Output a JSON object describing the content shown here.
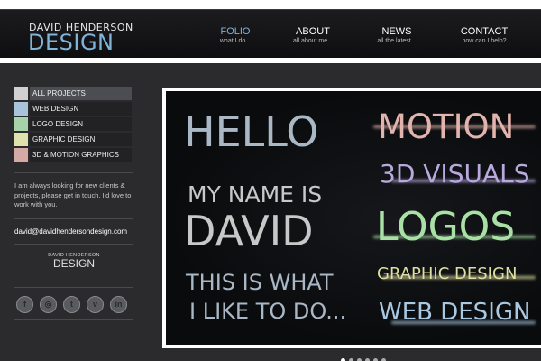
{
  "logo": {
    "top": "DAVID HENDERSON",
    "bottom": "DESIGN"
  },
  "nav": [
    {
      "label": "FOLIO",
      "sub": "what I do...",
      "active": true
    },
    {
      "label": "ABOUT",
      "sub": "all about me...",
      "active": false
    },
    {
      "label": "NEWS",
      "sub": "all the latest...",
      "active": false
    },
    {
      "label": "CONTACT",
      "sub": "how can I help?",
      "active": false
    }
  ],
  "categories": [
    {
      "label": "ALL PROJECTS",
      "color": "#d0d0d0",
      "active": true
    },
    {
      "label": "WEB DESIGN",
      "color": "#a8c4da"
    },
    {
      "label": "LOGO DESIGN",
      "color": "#a6d3a8"
    },
    {
      "label": "GRAPHIC DESIGN",
      "color": "#dfe2ad"
    },
    {
      "label": "3D & MOTION GRAPHICS",
      "color": "#d5aaa6"
    }
  ],
  "blurb": "I am always looking for new clients & projects, please get in touch. I'd love to work with you.",
  "email": "david@davidhendersondesign.com",
  "mini_logo": {
    "top": "DAVID HENDERSON",
    "bottom": "DESIGN"
  },
  "socials": [
    {
      "icon": "facebook-icon",
      "glyph": "f"
    },
    {
      "icon": "dribbble-icon",
      "glyph": "◎"
    },
    {
      "icon": "twitter-icon",
      "glyph": "t"
    },
    {
      "icon": "vimeo-icon",
      "glyph": "v"
    },
    {
      "icon": "linkedin-icon",
      "glyph": "in"
    }
  ],
  "slide": {
    "left": [
      "HELLO",
      "MY NAME IS",
      "DAVID",
      "THIS IS WHAT",
      "I LIKE TO DO..."
    ],
    "right": [
      {
        "text": "MOTION",
        "color": "#e3b3ad"
      },
      {
        "text": "3D VISUALS",
        "color": "#b9a9df"
      },
      {
        "text": "LOGOS",
        "color": "#a9e0a6"
      },
      {
        "text": "GRAPHIC DESIGN",
        "color": "#dfe0a0"
      },
      {
        "text": "WEB DESIGN",
        "color": "#a9c9e3"
      }
    ],
    "left_color": "#aab8c6",
    "mid_color": "#c8c8c8"
  },
  "slider_dots": 6
}
